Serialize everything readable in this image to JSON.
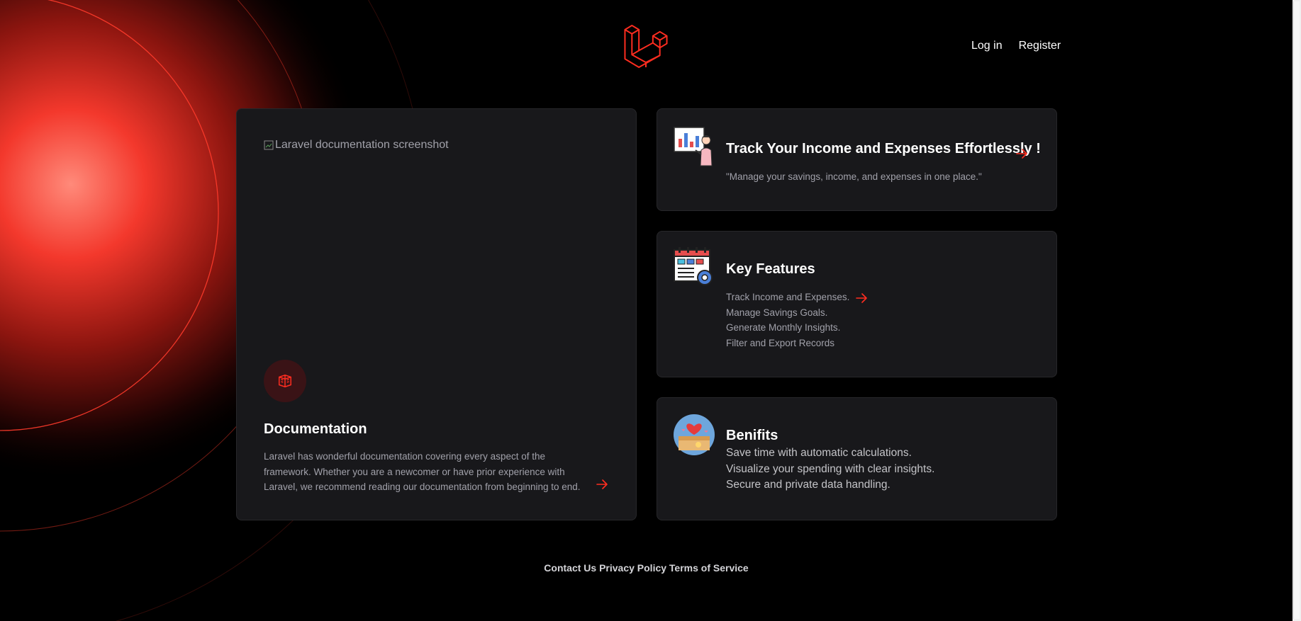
{
  "header": {
    "logo_icon": "laravel-logo-icon",
    "nav": {
      "login": "Log in",
      "register": "Register"
    }
  },
  "documentation_card": {
    "image_alt": "Laravel documentation screenshot",
    "icon": "book-icon",
    "title": "Documentation",
    "text": "Laravel has wonderful documentation covering every aspect of the framework. Whether you are a newcomer or have prior experience with Laravel, we recommend reading our documentation from beginning to end."
  },
  "track_card": {
    "icon": "presentation-chart-illustration-icon",
    "title": "Track Your Income and Expenses Effortlessly !",
    "text": "\"Manage your savings, income, and expenses in one place.\""
  },
  "features_card": {
    "icon": "calendar-settings-illustration-icon",
    "title": "Key Features",
    "items": [
      "Track Income and Expenses.",
      "Manage Savings Goals.",
      "Generate Monthly Insights.",
      "Filter and Export Records"
    ]
  },
  "benefits_card": {
    "icon": "heart-box-illustration-icon",
    "title": "Benifits",
    "items": [
      "Save time with automatic calculations.",
      "Visualize your spending with clear insights.",
      "Secure and private data handling."
    ]
  },
  "footer": {
    "contact": "Contact Us",
    "privacy": "Privacy Policy",
    "terms": "Terms of Service"
  },
  "colors": {
    "background": "#000000",
    "card": "#18181b",
    "accent": "#ff2d20",
    "muted_text": "#a1a1aa"
  }
}
